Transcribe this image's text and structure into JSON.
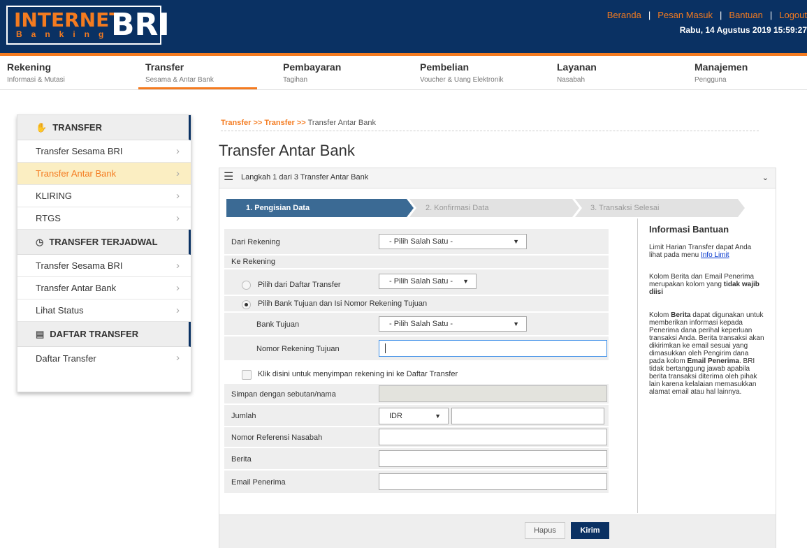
{
  "logo": {
    "internet": "INTERNET",
    "banking": "Banking",
    "bri": "BRI"
  },
  "topnav": {
    "beranda": "Beranda",
    "pesan_masuk": "Pesan Masuk",
    "bantuan": "Bantuan",
    "logout": "Logout",
    "datetime": "Rabu, 14 Agustus 2019 15:59:27"
  },
  "menu": [
    {
      "title": "Rekening",
      "sub": "Informasi & Mutasi"
    },
    {
      "title": "Transfer",
      "sub": "Sesama & Antar Bank"
    },
    {
      "title": "Pembayaran",
      "sub": "Tagihan"
    },
    {
      "title": "Pembelian",
      "sub": "Voucher & Uang Elektronik"
    },
    {
      "title": "Layanan",
      "sub": "Nasabah"
    },
    {
      "title": "Manajemen",
      "sub": "Pengguna"
    }
  ],
  "sidebar": {
    "transfer_head": "TRANSFER",
    "transfer_items": [
      "Transfer Sesama BRI",
      "Transfer Antar Bank",
      "KLIRING",
      "RTGS"
    ],
    "terjadwal_head": "TRANSFER TERJADWAL",
    "terjadwal_items": [
      "Transfer Sesama BRI",
      "Transfer Antar Bank",
      "Lihat Status"
    ],
    "daftar_head": "DAFTAR TRANSFER",
    "daftar_items": [
      "Daftar Transfer"
    ]
  },
  "breadcrumb": {
    "part1": "Transfer >>",
    "part2": "Transfer >>",
    "part3": "Transfer Antar Bank"
  },
  "page_title": "Transfer Antar Bank",
  "panel_title": "Langkah 1 dari 3 Transfer Antar Bank",
  "steps": [
    "1. Pengisian Data",
    "2. Konfirmasi Data",
    "3. Transaksi Selesai"
  ],
  "form": {
    "dari_rekening": "Dari Rekening",
    "ke_rekening": "Ke Rekening",
    "pilih_daftar": "Pilih dari Daftar Transfer",
    "pilih_bank": "Pilih Bank Tujuan dan Isi Nomor Rekening Tujuan",
    "bank_tujuan": "Bank Tujuan",
    "nomor_rekening_tujuan": "Nomor Rekening Tujuan",
    "simpan_check": "Klik disini untuk menyimpan rekening ini ke Daftar Transfer",
    "simpan_nama": "Simpan dengan sebutan/nama",
    "jumlah": "Jumlah",
    "nomor_referensi": "Nomor Referensi Nasabah",
    "berita": "Berita",
    "email_penerima": "Email Penerima",
    "select_placeholder": "- Pilih Salah Satu -",
    "currency": "IDR"
  },
  "help": {
    "title": "Informasi Bantuan",
    "p1": "Limit Harian Transfer dapat Anda lihat pada menu",
    "p1_link": "Info Limit",
    "p2a": "Kolom Berita dan Email Penerima merupakan kolom yang",
    "p2b": "tidak wajib diisi",
    "p3a": "Kolom",
    "p3b": "Berita",
    "p3c": "dapat digunakan untuk memberikan informasi kepada Penerima dana perihal keperluan transaksi Anda. Berita transaksi akan dikirimkan ke email sesuai yang dimasukkan oleh Pengirim dana pada kolom",
    "p3d": "Email Penerima",
    "p3e": ". BRI tidak bertanggung jawab apabila berita transaksi diterima oleh pihak lain karena kelalaian memasukkan alamat email atau hal lainnya."
  },
  "buttons": {
    "hapus": "Hapus",
    "kirim": "Kirim"
  },
  "colors": {
    "navy": "#0a3163",
    "orange": "#f47b20",
    "step_active": "#3b6a94"
  }
}
